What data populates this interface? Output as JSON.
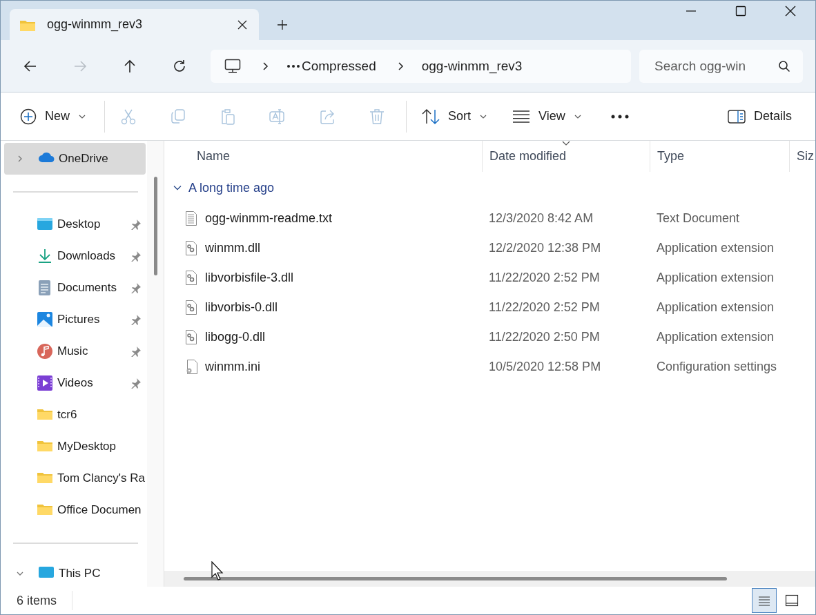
{
  "tabs": [
    {
      "title": "ogg-winmm_rev3",
      "selected": true
    }
  ],
  "nav_buttons": [
    {
      "kind": "back",
      "disabled": false
    },
    {
      "kind": "forward",
      "disabled": true
    },
    {
      "kind": "up",
      "disabled": false
    },
    {
      "kind": "refresh",
      "disabled": false
    }
  ],
  "breadcrumbs": [
    "Compressed",
    "ogg-winmm_rev3"
  ],
  "search": {
    "placeholder": "Search ogg-win"
  },
  "toolbar": {
    "new": {
      "label": "New"
    },
    "actions": [
      {
        "kind": "cut",
        "disabled": true
      },
      {
        "kind": "copy",
        "disabled": true
      },
      {
        "kind": "paste",
        "disabled": true
      },
      {
        "kind": "rename",
        "disabled": true
      },
      {
        "kind": "share",
        "disabled": true
      },
      {
        "kind": "delete",
        "disabled": true
      }
    ],
    "sort": {
      "label": "Sort"
    },
    "view": {
      "label": "View"
    },
    "details": {
      "label": "Details"
    }
  },
  "sidebar": {
    "top": {
      "label": "OneDrive",
      "kind": "cloud",
      "selected": true,
      "expanded": false
    },
    "items": [
      {
        "label": "Desktop",
        "kind": "desktop",
        "pinned": true,
        "selected": false
      },
      {
        "label": "Downloads",
        "kind": "download",
        "pinned": true,
        "selected": false
      },
      {
        "label": "Documents",
        "kind": "documents",
        "pinned": true,
        "selected": false
      },
      {
        "label": "Pictures",
        "kind": "pictures",
        "pinned": true,
        "selected": false
      },
      {
        "label": "Music",
        "kind": "music",
        "pinned": true,
        "selected": false
      },
      {
        "label": "Videos",
        "kind": "videos",
        "pinned": true,
        "selected": false
      },
      {
        "label": "tcr6",
        "kind": "folder",
        "pinned": false,
        "selected": false
      },
      {
        "label": "MyDesktop",
        "kind": "folder",
        "pinned": false,
        "selected": false
      },
      {
        "label": "Tom Clancy's Ra",
        "kind": "folder",
        "pinned": false,
        "selected": false
      },
      {
        "label": "Office Documen",
        "kind": "folder",
        "pinned": false,
        "selected": false
      }
    ],
    "bottom": {
      "label": "This PC",
      "kind": "pc",
      "selected": false,
      "expanded": true
    }
  },
  "table": {
    "columns": [
      {
        "label": "Name",
        "sorted": false
      },
      {
        "label": "Date modified",
        "sorted": true
      },
      {
        "label": "Type",
        "sorted": false
      },
      {
        "label": "Siz",
        "sorted": false
      }
    ],
    "group": {
      "label": "A long time ago",
      "expanded": true
    },
    "rows": [
      {
        "name": "ogg-winmm-readme.txt",
        "date": "12/3/2020 8:42 AM",
        "type": "Text Document",
        "kind": "text"
      },
      {
        "name": "winmm.dll",
        "date": "12/2/2020 12:38 PM",
        "type": "Application extension",
        "kind": "dll"
      },
      {
        "name": "libvorbisfile-3.dll",
        "date": "11/22/2020 2:52 PM",
        "type": "Application extension",
        "kind": "dll"
      },
      {
        "name": "libvorbis-0.dll",
        "date": "11/22/2020 2:52 PM",
        "type": "Application extension",
        "kind": "dll"
      },
      {
        "name": "libogg-0.dll",
        "date": "11/22/2020 2:50 PM",
        "type": "Application extension",
        "kind": "dll"
      },
      {
        "name": "winmm.ini",
        "date": "10/5/2020 12:58 PM",
        "type": "Configuration settings",
        "kind": "ini"
      }
    ]
  },
  "status_bar": {
    "count": "6 items",
    "views": [
      {
        "kind": "details",
        "selected": true
      },
      {
        "kind": "tiles",
        "selected": false
      }
    ]
  }
}
